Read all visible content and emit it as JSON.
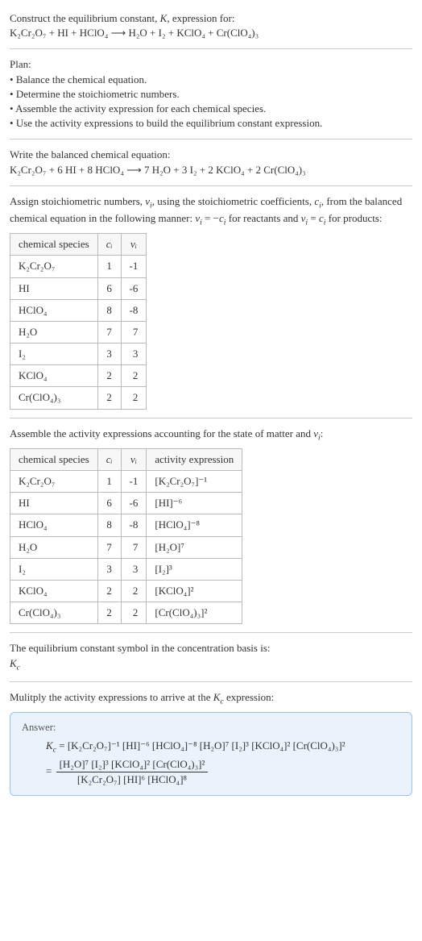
{
  "intro": {
    "line1_a": "Construct the equilibrium constant, ",
    "line1_K": "K",
    "line1_b": ", expression for:",
    "reaction_unbalanced": "K₂Cr₂O₇ + HI + HClO₄  ⟶  H₂O + I₂ + KClO₄ + Cr(ClO₄)₃"
  },
  "plan": {
    "heading": "Plan:",
    "items": [
      "Balance the chemical equation.",
      "Determine the stoichiometric numbers.",
      "Assemble the activity expression for each chemical species.",
      "Use the activity expressions to build the equilibrium constant expression."
    ]
  },
  "balanced": {
    "heading": "Write the balanced chemical equation:",
    "equation": "K₂Cr₂O₇ + 6 HI + 8 HClO₄  ⟶  7 H₂O + 3 I₂ + 2 KClO₄ + 2 Cr(ClO₄)₃"
  },
  "stoich": {
    "text_a": "Assign stoichiometric numbers, ",
    "nu": "ν",
    "sub_i": "i",
    "text_b": ", using the stoichiometric coefficients, ",
    "c": "c",
    "text_c": ", from the balanced chemical equation in the following manner: ",
    "rel_reactants_a": "ν",
    "rel_reactants_b": " = −",
    "rel_reactants_c": "c",
    "rel_reactants_d": " for reactants and ",
    "rel_products_a": "ν",
    "rel_products_b": " = ",
    "rel_products_c": "c",
    "rel_products_d": " for products:",
    "headers": {
      "species": "chemical species",
      "ci": "cᵢ",
      "nui": "νᵢ"
    },
    "rows": [
      {
        "species": "K₂Cr₂O₇",
        "ci": "1",
        "nui": "-1"
      },
      {
        "species": "HI",
        "ci": "6",
        "nui": "-6"
      },
      {
        "species": "HClO₄",
        "ci": "8",
        "nui": "-8"
      },
      {
        "species": "H₂O",
        "ci": "7",
        "nui": "7"
      },
      {
        "species": "I₂",
        "ci": "3",
        "nui": "3"
      },
      {
        "species": "KClO₄",
        "ci": "2",
        "nui": "2"
      },
      {
        "species": "Cr(ClO₄)₃",
        "ci": "2",
        "nui": "2"
      }
    ]
  },
  "activity": {
    "heading_a": "Assemble the activity expressions accounting for the state of matter and ",
    "heading_b": ":",
    "headers": {
      "species": "chemical species",
      "ci": "cᵢ",
      "nui": "νᵢ",
      "act": "activity expression"
    },
    "rows": [
      {
        "species": "K₂Cr₂O₇",
        "ci": "1",
        "nui": "-1",
        "act": "[K₂Cr₂O₇]⁻¹"
      },
      {
        "species": "HI",
        "ci": "6",
        "nui": "-6",
        "act": "[HI]⁻⁶"
      },
      {
        "species": "HClO₄",
        "ci": "8",
        "nui": "-8",
        "act": "[HClO₄]⁻⁸"
      },
      {
        "species": "H₂O",
        "ci": "7",
        "nui": "7",
        "act": "[H₂O]⁷"
      },
      {
        "species": "I₂",
        "ci": "3",
        "nui": "3",
        "act": "[I₂]³"
      },
      {
        "species": "KClO₄",
        "ci": "2",
        "nui": "2",
        "act": "[KClO₄]²"
      },
      {
        "species": "Cr(ClO₄)₃",
        "ci": "2",
        "nui": "2",
        "act": "[Cr(ClO₄)₃]²"
      }
    ]
  },
  "kc_symbol": {
    "heading": "The equilibrium constant symbol in the concentration basis is:",
    "symbol_a": "K",
    "symbol_b": "c"
  },
  "multiply": {
    "heading_a": "Mulitply the activity expressions to arrive at the ",
    "heading_b": " expression:"
  },
  "answer": {
    "label": "Answer:",
    "line1": "Kc = [K₂Cr₂O₇]⁻¹ [HI]⁻⁶ [HClO₄]⁻⁸ [H₂O]⁷ [I₂]³ [KClO₄]² [Cr(ClO₄)₃]²",
    "line2_eq": "= ",
    "frac_num": "[H₂O]⁷ [I₂]³ [KClO₄]² [Cr(ClO₄)₃]²",
    "frac_den": "[K₂Cr₂O₇] [HI]⁶ [HClO₄]⁸"
  }
}
